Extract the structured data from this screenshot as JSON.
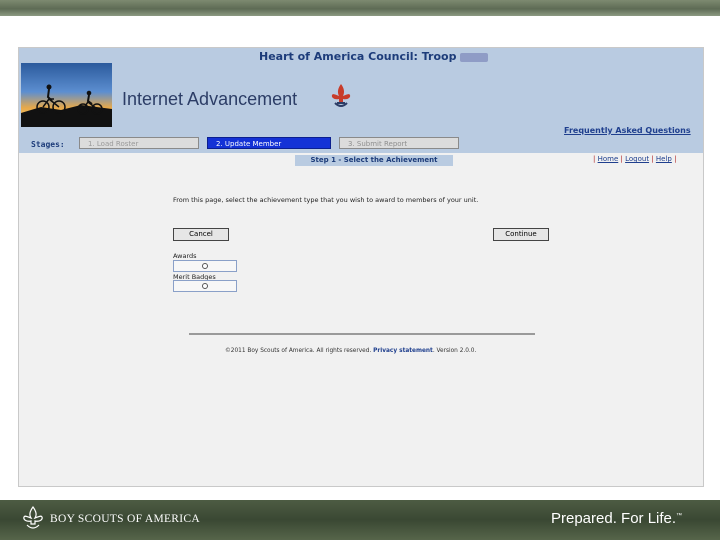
{
  "header": {
    "council_title": "Heart of America Council: Troop",
    "app_title": "Internet Advancement",
    "faq_label": "Frequently Asked Questions"
  },
  "stages": {
    "label": "Stages:",
    "items": [
      {
        "label": "1. Load Roster",
        "state": "inactive"
      },
      {
        "label": "2. Update Member",
        "state": "active"
      },
      {
        "label": "3. Submit Report",
        "state": "inactive"
      }
    ]
  },
  "step": {
    "label": "Step 1 - Select the Achievement"
  },
  "nav_links": {
    "separator": "|",
    "home": "Home",
    "logout": "Logout",
    "help": "Help"
  },
  "content": {
    "instructions": "From this page, select the achievement type that you wish to award to members of your unit.",
    "cancel_label": "Cancel",
    "continue_label": "Continue",
    "options": [
      {
        "label": "Awards",
        "selected": false
      },
      {
        "label": "Merit Badges",
        "selected": false
      }
    ]
  },
  "footer": {
    "copyright": "©2011 Boy Scouts of America. All rights reserved.",
    "privacy_label": "Privacy statement",
    "version": ". Version 2.0.0."
  },
  "branding": {
    "org_name": "BOY SCOUTS OF AMERICA",
    "tagline": "Prepared. For Life.",
    "trademark": "™"
  },
  "colors": {
    "header_bg": "#b9cbe1",
    "active_stage": "#1432d6",
    "link": "#1f3f8e"
  }
}
